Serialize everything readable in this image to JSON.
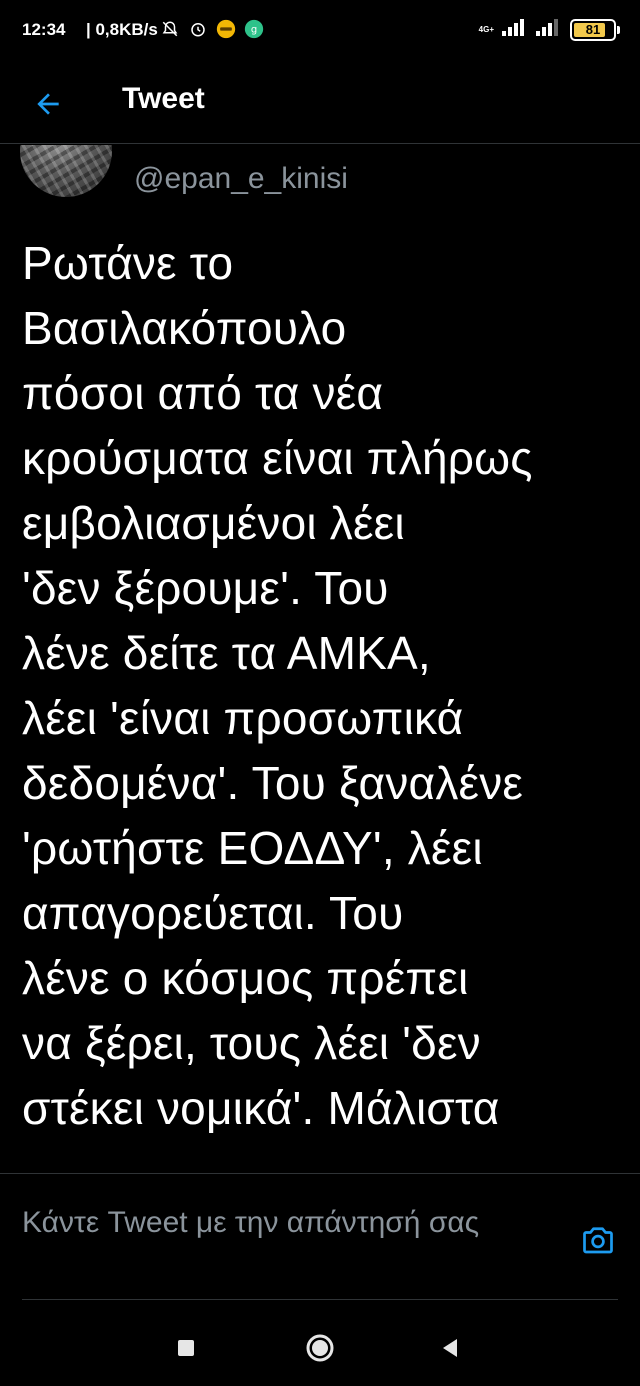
{
  "status_bar": {
    "time": "12:34",
    "speed": "| 0,8KB/s",
    "network": "4G+",
    "battery": "81",
    "battery_level_percent": 81,
    "icons": [
      "alarm-off-icon",
      "alarm-clock-icon",
      "bank-app-icon",
      "green-app-icon"
    ]
  },
  "header": {
    "title": "Tweet",
    "back_icon": "arrow-left-icon",
    "accent_color": "#1d9bf0"
  },
  "tweet": {
    "username": "@epan_e_kinisi",
    "text": "Ρωτάνε το\nΒασιλακόπουλο\nπόσοι από τα νέα\nκρούσματα είναι πλήρως\nεμβολιασμένοι λέει\n'δεν ξέρουμε'. Του\nλένε δείτε τα ΑΜΚΑ,\nλέει 'είναι προσωπικά\nδεδομένα'. Του ξαναλένε\n'ρωτήστε ΕΟΔΔΥ', λέει\nαπαγορεύεται. Του\nλένε ο κόσμος πρέπει\nνα ξέρει, τους λέει 'δεν\nστέκει νομικά'. Μάλιστα"
  },
  "reply": {
    "placeholder": "Κάντε Tweet με την απάντησή σας",
    "camera_icon": "camera-icon"
  },
  "nav_bar": {
    "icons": [
      "recent-apps-icon",
      "home-icon",
      "back-icon"
    ]
  },
  "colors": {
    "background": "#000000",
    "text": "#ffffff",
    "secondary_text": "#8b949c",
    "divider": "#2f3336",
    "accent": "#1d9bf0"
  }
}
